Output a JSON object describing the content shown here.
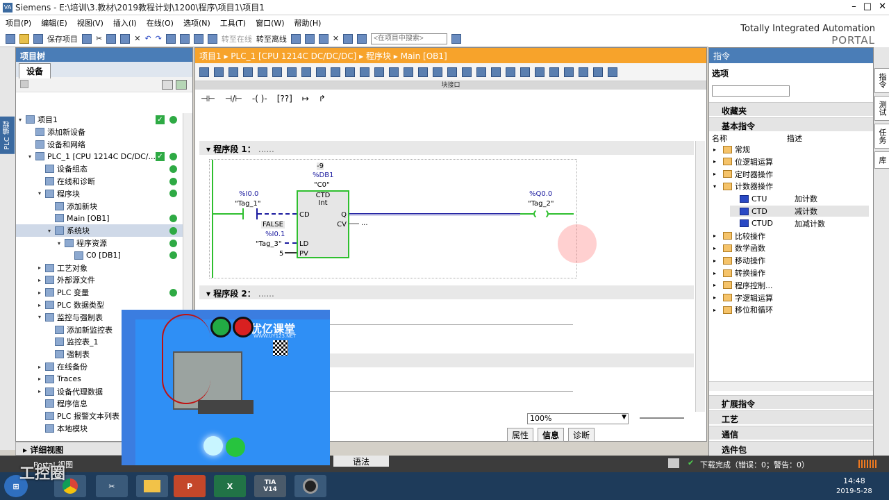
{
  "window": {
    "title": "Siemens  -  E:\\培训\\3.教材\\2019教程计划\\1200\\程序\\项目1\\项目1"
  },
  "menu": [
    "项目(P)",
    "编辑(E)",
    "视图(V)",
    "插入(I)",
    "在线(O)",
    "选项(N)",
    "工具(T)",
    "窗口(W)",
    "帮助(H)"
  ],
  "toolbar": {
    "save": "保存项目",
    "go_online": "转至在线",
    "go_offline": "转至离线",
    "search_placeholder": "<在项目中搜索>"
  },
  "brand": {
    "line1": "Totally Integrated Automation",
    "line2": "PORTAL"
  },
  "project_tree": {
    "title": "项目树",
    "tab": "设备",
    "side_label": "PLC 编程",
    "items": [
      {
        "label": "项目1",
        "indent": 0
      },
      {
        "label": "添加新设备",
        "indent": 1
      },
      {
        "label": "设备和网络",
        "indent": 1
      },
      {
        "label": "PLC_1 [CPU 1214C DC/DC/...",
        "indent": 1
      },
      {
        "label": "设备组态",
        "indent": 2
      },
      {
        "label": "在线和诊断",
        "indent": 2
      },
      {
        "label": "程序块",
        "indent": 2
      },
      {
        "label": "添加新块",
        "indent": 3
      },
      {
        "label": "Main [OB1]",
        "indent": 3
      },
      {
        "label": "系统块",
        "indent": 3
      },
      {
        "label": "程序资源",
        "indent": 4
      },
      {
        "label": "C0 [DB1]",
        "indent": 5
      },
      {
        "label": "工艺对象",
        "indent": 2
      },
      {
        "label": "外部源文件",
        "indent": 2
      },
      {
        "label": "PLC 变量",
        "indent": 2
      },
      {
        "label": "PLC 数据类型",
        "indent": 2
      },
      {
        "label": "监控与强制表",
        "indent": 2
      },
      {
        "label": "添加新监控表",
        "indent": 3
      },
      {
        "label": "监控表_1",
        "indent": 3
      },
      {
        "label": "强制表",
        "indent": 3
      },
      {
        "label": "在线备份",
        "indent": 2
      },
      {
        "label": "Traces",
        "indent": 2
      },
      {
        "label": "设备代理数据",
        "indent": 2
      },
      {
        "label": "程序信息",
        "indent": 2
      },
      {
        "label": "PLC 报警文本列表",
        "indent": 2
      },
      {
        "label": "本地模块",
        "indent": 2
      }
    ]
  },
  "editor": {
    "breadcrumb": "项目1  ▸  PLC_1 [CPU 1214C DC/DC/DC]  ▸  程序块  ▸  Main [OB1]",
    "block_interface": "块接口",
    "ladder_tools": [
      "⊣⊢",
      "⊣/⊢",
      "-( )-",
      "[??]",
      "↦",
      "↱"
    ],
    "network1": "程序段 1：",
    "network1_comment": "......",
    "network2": "程序段 2：",
    "network2_comment": "......",
    "rung": {
      "counter_value": "-9",
      "db": "%DB1",
      "db_name": "\"C0\"",
      "block_type": "CTD",
      "block_datatype": "Int",
      "in_addr": "%I0.0",
      "in_tag": "\"Tag_1\"",
      "false_label": "FALSE",
      "ld_addr": "%I0.1",
      "ld_tag": "\"Tag_3\"",
      "pv_value": "5",
      "out_addr": "%Q0.0",
      "out_tag": "\"Tag_2\"",
      "pin_cd": "CD",
      "pin_ld": "LD",
      "pin_pv": "PV",
      "pin_q": "Q",
      "pin_cv": "CV",
      "cv_dots": "..."
    },
    "zoom": "100%"
  },
  "info_tabs": [
    "属性",
    "信息",
    "诊断"
  ],
  "detail_view": "详细视图",
  "right_panel": {
    "title": "指令",
    "options": "选项",
    "favorites": "收藏夹",
    "basic": "基本指令",
    "col_name": "名称",
    "col_desc": "描述",
    "instructions": [
      {
        "name": "常规",
        "desc": "",
        "level": 0
      },
      {
        "name": "位逻辑运算",
        "desc": "",
        "level": 0
      },
      {
        "name": "定时器操作",
        "desc": "",
        "level": 0
      },
      {
        "name": "计数器操作",
        "desc": "",
        "level": 0
      },
      {
        "name": "CTU",
        "desc": "加计数",
        "level": 1
      },
      {
        "name": "CTD",
        "desc": "减计数",
        "level": 1
      },
      {
        "name": "CTUD",
        "desc": "加减计数",
        "level": 1
      },
      {
        "name": "比较操作",
        "desc": "",
        "level": 0
      },
      {
        "name": "数学函数",
        "desc": "",
        "level": 0
      },
      {
        "name": "移动操作",
        "desc": "",
        "level": 0
      },
      {
        "name": "转换操作",
        "desc": "",
        "level": 0
      },
      {
        "name": "程序控制...",
        "desc": "",
        "level": 0
      },
      {
        "name": "字逻辑运算",
        "desc": "",
        "level": 0
      },
      {
        "name": "移位和循环",
        "desc": "",
        "level": 0
      }
    ],
    "extended": "扩展指令",
    "technology": "工艺",
    "communication": "通信",
    "optional": "选件包",
    "side_tabs": [
      "指令",
      "测试",
      "任务",
      "库"
    ]
  },
  "statusbar": {
    "portal_view": "Portal 视图",
    "syntax": "语法",
    "message": "下载完成（错误：0；警告：0）"
  },
  "taskbar": {
    "time": "14:48",
    "date": "2019-5-28",
    "tia": "TIA\nV14"
  },
  "overlay": {
    "brand": "优亿课堂",
    "url": "WWW.UY123.NET"
  },
  "watermark": "工控圈"
}
